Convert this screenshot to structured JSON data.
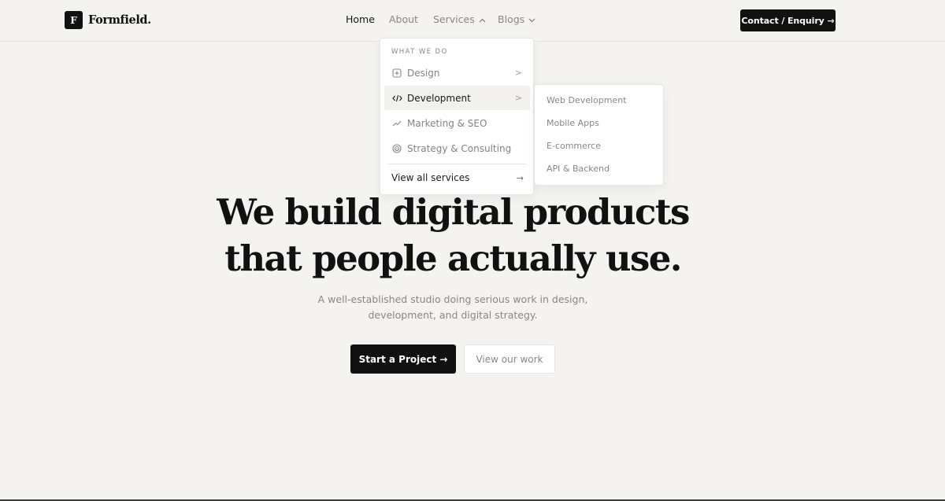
{
  "brand": {
    "logo_letter": "F",
    "name": "Formfield."
  },
  "nav": {
    "items": [
      {
        "label": "Home",
        "active": true
      },
      {
        "label": "About"
      },
      {
        "label": "Services",
        "icon": "chevron-up-icon"
      },
      {
        "label": "Blogs",
        "icon": "chevron-down-icon"
      }
    ],
    "contact_label": "Contact / Enquiry →"
  },
  "dropdown": {
    "heading": "WHAT WE DO",
    "items": [
      {
        "label": "Design",
        "icon": "plus-square-icon",
        "arrow": ">"
      },
      {
        "label": "Development",
        "icon": "code-icon",
        "arrow": ">",
        "active": true
      },
      {
        "label": "Marketing & SEO",
        "icon": "trend-line-icon"
      },
      {
        "label": "Strategy & Consulting",
        "icon": "target-icon"
      }
    ],
    "view_all": {
      "label": "View all services",
      "arrow": "→"
    }
  },
  "submenu": {
    "items": [
      "Web Development",
      "Mobile Apps",
      "E-commerce",
      "API & Backend"
    ]
  },
  "hero": {
    "title_line1": "We build digital products",
    "title_line2": "that people actually use.",
    "subtitle_line1": "A well-established studio doing serious work in design,",
    "subtitle_line2": "development, and digital strategy.",
    "primary_cta": "Start a Project →",
    "secondary_cta": "View our work"
  },
  "colors": {
    "background": "#f4f3f0",
    "accent": "#111111",
    "muted_text": "#8a8782",
    "surface": "#ffffff"
  }
}
